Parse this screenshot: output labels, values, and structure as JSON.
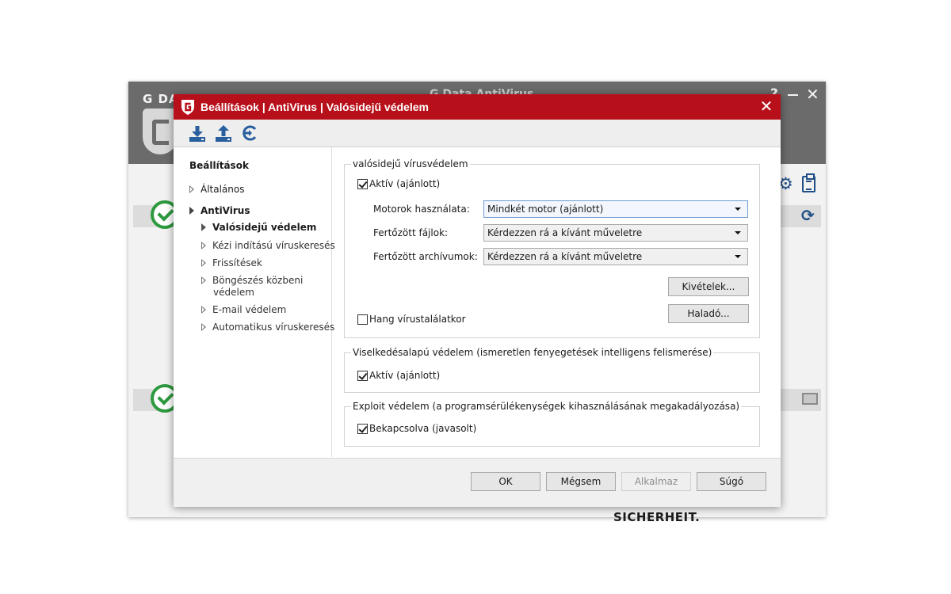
{
  "background_window": {
    "logo_text": "G DATA",
    "title": "G Data AntiVirus",
    "help_glyph": "?",
    "close_glyph": "✕",
    "tagline": "TRUST IN GERMAN SICHERHEIT.",
    "icons": [
      "shield-logo-icon",
      "green-check-icon",
      "gear-icon",
      "clipboard-icon",
      "refresh-icon",
      "mail-icon"
    ],
    "accent_color": "#1f4f86",
    "ok_color": "#2e9a3f"
  },
  "dialog": {
    "title": "Beállítások | AntiVirus | Valósidejű védelem",
    "close_glyph": "✕",
    "titlebar_color": "#b8101a",
    "toolbar": {
      "icons": [
        "import-icon",
        "export-icon",
        "restore-defaults-icon"
      ]
    },
    "sidebar": {
      "title": "Beállítások",
      "items": {
        "general": "Általános",
        "antivirus": "AntiVirus",
        "realtime": "Valósidejű védelem",
        "manual_scan": "Kézi indítású víruskeresés",
        "updates": "Frissítések",
        "browser_protection_1": "Böngészés közbeni",
        "browser_protection_2": "védelem",
        "email_protection": "E-mail védelem",
        "auto_scan": "Automatikus víruskeresés"
      }
    },
    "realtime_group": {
      "legend": "valósidejű vírusvédelem",
      "active_label": "Aktív (ajánlott)",
      "active_checked": true,
      "engines_label": "Motorok használata:",
      "engines_value": "Mindkét motor (ajánlott)",
      "infected_files_label": "Fertőzött fájlok:",
      "infected_files_value": "Kérdezzen rá a kívánt műveletre",
      "infected_archives_label": "Fertőzött archívumok:",
      "infected_archives_value": "Kérdezzen rá a kívánt műveletre",
      "exceptions_button": "Kivételek...",
      "advanced_button": "Haladó...",
      "sound_label": "Hang vírustalálatkor",
      "sound_checked": false
    },
    "behavior_group": {
      "legend": "Viselkedésalapú védelem (ismeretlen fenyegetések intelligens felismerése)",
      "active_label": "Aktív (ajánlott)",
      "active_checked": true
    },
    "exploit_group": {
      "legend": "Exploit védelem (a programsérülékenységek kihasználásának megakadályozása)",
      "enabled_label": "Bekapcsolva (javasolt)",
      "enabled_checked": true
    },
    "footer": {
      "ok": "OK",
      "cancel": "Mégsem",
      "apply": "Alkalmaz",
      "help": "Súgó"
    }
  }
}
